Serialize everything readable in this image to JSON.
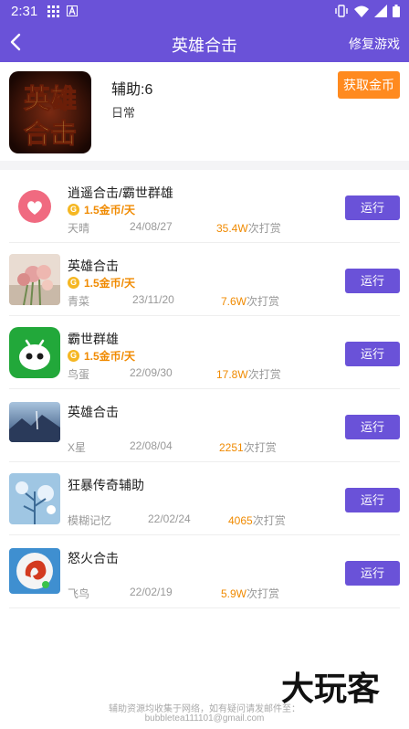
{
  "status_bar": {
    "time": "2:31",
    "left_icons": [
      "grid-icon",
      "a-icon"
    ],
    "right_icons": [
      "vibrate-icon",
      "wifi-icon",
      "signal-icon",
      "battery-icon"
    ]
  },
  "app_bar": {
    "title": "英雄合击",
    "action_label": "修复游戏",
    "color": "#6a52d8"
  },
  "game": {
    "logo_text_top": "英雄",
    "logo_text_bottom": "合击",
    "assist_count": "辅助:6",
    "category": "日常",
    "get_coins_label": "获取金币"
  },
  "items": [
    {
      "name": "逍遥合击/霸世群雄",
      "coin": "1.5金币/天",
      "author": "天晴",
      "date": "24/08/27",
      "reward_num": "35.4W",
      "reward_suffix": "次打赏",
      "run": "运行",
      "thumb": "heart-thumb"
    },
    {
      "name": "英雄合击",
      "coin": "1.5金币/天",
      "author": "青菜",
      "date": "23/11/20",
      "reward_num": "7.6W",
      "reward_suffix": "次打赏",
      "run": "运行",
      "thumb": "flowers-thumb"
    },
    {
      "name": "霸世群雄",
      "coin": "1.5金币/天",
      "author": "鸟蛋",
      "date": "22/09/30",
      "reward_num": "17.8W",
      "reward_suffix": "次打赏",
      "run": "运行",
      "thumb": "android-thumb"
    },
    {
      "name": "英雄合击",
      "coin": "",
      "author": "X星",
      "date": "22/08/04",
      "reward_num": "2251",
      "reward_suffix": "次打赏",
      "run": "运行",
      "thumb": "landscape-thumb"
    },
    {
      "name": "狂暴传奇辅助",
      "coin": "",
      "author": "模糊记忆",
      "date": "22/02/24",
      "reward_num": "4065",
      "reward_suffix": "次打赏",
      "run": "运行",
      "thumb": "tree-thumb"
    },
    {
      "name": "怒火合击",
      "coin": "",
      "author": "飞鸟",
      "date": "22/02/19",
      "reward_num": "5.9W",
      "reward_suffix": "次打赏",
      "run": "运行",
      "thumb": "dragon-thumb"
    }
  ],
  "footer": {
    "line1": "辅助资源均收集于网络，如有疑问请发邮件至：",
    "line2": "bubbletea111101@gmail.com",
    "watermark": "大玩客"
  }
}
